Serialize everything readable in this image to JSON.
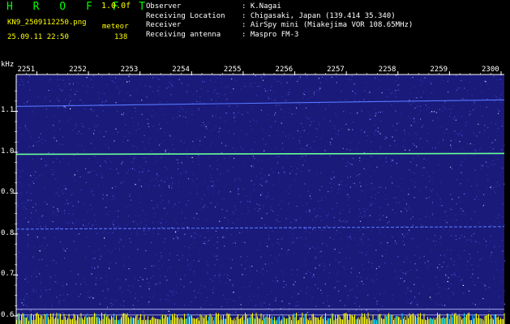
{
  "header": {
    "app_title": "H R O F F T",
    "version": "1.0.0f",
    "filename": "KN9_2509112250.png",
    "datetime": "25.09.11 22:50",
    "detection_label": "meteor",
    "detection_count": "138"
  },
  "info": [
    {
      "key": "Observer",
      "value": ": K.Nagai"
    },
    {
      "key": "Receiving Location",
      "value": ": Chigasaki, Japan (139.414 35.340)"
    },
    {
      "key": "Receiver",
      "value": ": AirSpy mini (Miakejima VOR 108.65MHz)"
    },
    {
      "key": "Receiving antenna",
      "value": ": Maspro FM-3"
    }
  ],
  "colors": {
    "background": "#000000",
    "waterfall_base": "#1a1a7a",
    "carrier_line": "#66ff99",
    "trace_line": "#5577ff",
    "text_header": "#ffff00",
    "text_title": "#00ff00",
    "meteor_bar": "#ffff00"
  },
  "chart_data": {
    "type": "heatmap",
    "y_unit_label": "kHz",
    "x_ticks": [
      "2251",
      "2252",
      "2253",
      "2254",
      "2255",
      "2256",
      "2257",
      "2258",
      "2259",
      "2300"
    ],
    "y_ticks": [
      "1.1",
      "1.0",
      "0.9",
      "0.8",
      "0.7",
      "0.6"
    ],
    "ylim": [
      0.58,
      1.19
    ],
    "xlim": [
      2250.6,
      2300.0
    ],
    "lines": [
      {
        "name": "upper trace",
        "y_start": 1.112,
        "y_end": 1.128
      },
      {
        "name": "carrier",
        "y_start": 0.995,
        "y_end": 0.997
      },
      {
        "name": "lower trace",
        "y_start": 0.812,
        "y_end": 0.818
      }
    ],
    "reference_lines": [
      0.616,
      0.602
    ]
  }
}
